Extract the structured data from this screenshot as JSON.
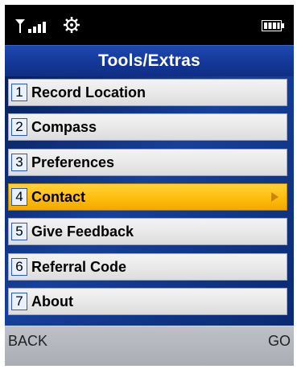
{
  "status": {
    "signal_icon": "signal-strength-icon",
    "settings_icon": "gear-icon",
    "battery_icon": "battery-icon"
  },
  "header": {
    "title": "Tools/Extras"
  },
  "menu": {
    "items": [
      {
        "number": "1",
        "label": "Record Location"
      },
      {
        "number": "2",
        "label": "Compass"
      },
      {
        "number": "3",
        "label": "Preferences"
      },
      {
        "number": "4",
        "label": "Contact",
        "selected": true,
        "has_submenu": true
      },
      {
        "number": "5",
        "label": "Give Feedback"
      },
      {
        "number": "6",
        "label": "Referral Code"
      },
      {
        "number": "7",
        "label": "About"
      }
    ]
  },
  "softkeys": {
    "left": "BACK",
    "right": "GO"
  },
  "colors": {
    "title_bar": "#15399a",
    "selected_item": "#ffbf10",
    "softkey_bar": "#b3b6bd"
  }
}
